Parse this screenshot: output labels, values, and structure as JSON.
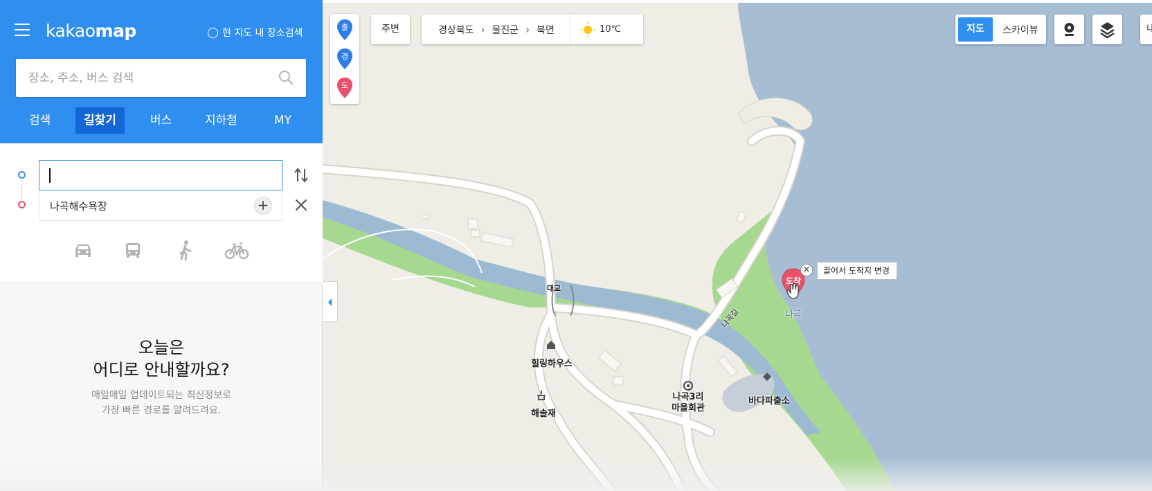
{
  "sidebar": {
    "logo_prefix": "kakao",
    "logo_suffix": "map",
    "current_map_search": "현 지도 내 장소검색",
    "search": {
      "placeholder": "장소, 주소, 버스 검색"
    },
    "tabs": [
      {
        "label": "검색"
      },
      {
        "label": "길찾기"
      },
      {
        "label": "버스"
      },
      {
        "label": "지하철"
      },
      {
        "label": "MY"
      }
    ],
    "route": {
      "start_value": "",
      "end_value": "나곡해수욕장",
      "add_label": "+"
    },
    "empty": {
      "title_line1": "오늘은",
      "title_line2": "어디로 안내할까요?",
      "sub_line1": "매일매일 업데이트되는 최신정보로",
      "sub_line2": "가장 빠른 경로를 알려드려요."
    }
  },
  "map": {
    "pins": [
      "출",
      "경",
      "도"
    ],
    "nearby_label": "주변",
    "breadcrumb": [
      "경상북도",
      "울진군",
      "북면"
    ],
    "weather": {
      "icon": "sun-icon",
      "temp": "10℃"
    },
    "map_types": {
      "active": "지도",
      "other": "스카이뷰"
    },
    "partial_label": "내",
    "dest_marker_label": "도착",
    "tooltip": "끌어서 도착지 변경",
    "tooltip_close": "×",
    "places": {
      "bridge": "대교",
      "healing": "힐링하우스",
      "haesol": "해솔재",
      "village": [
        "나곡3리",
        "마을회관"
      ],
      "police": "바다파출소",
      "nagok": "나곡",
      "road": "나곡길"
    }
  },
  "colors": {
    "brand_blue": "#2f8ef0",
    "active_tab": "#1266d6",
    "sea": "#a6bdd3",
    "river": "#9dbad3",
    "green": "#a6d890",
    "land": "#efede6",
    "dest_red": "#e9506a"
  }
}
